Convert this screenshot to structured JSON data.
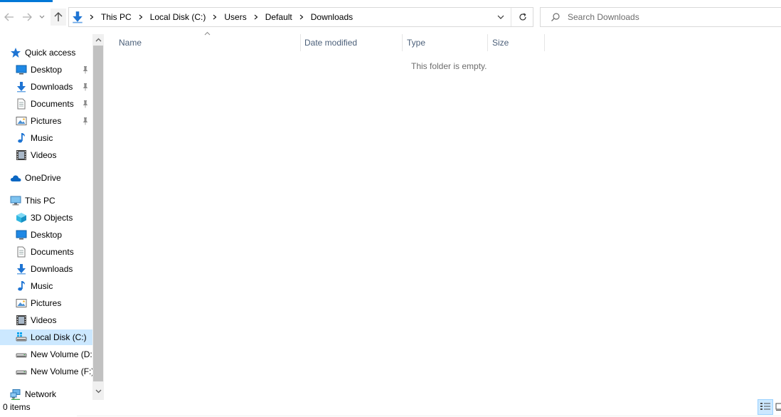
{
  "window": {
    "accent_color": "#0078d7"
  },
  "address_bar": {
    "breadcrumbs": [
      "This PC",
      "Local Disk (C:)",
      "Users",
      "Default",
      "Downloads"
    ]
  },
  "search": {
    "placeholder": "Search Downloads"
  },
  "nav_pane": {
    "quick_access": {
      "label": "Quick access",
      "items": [
        {
          "label": "Desktop",
          "icon": "desktop-icon",
          "pinned": true
        },
        {
          "label": "Downloads",
          "icon": "downloads-icon",
          "pinned": true
        },
        {
          "label": "Documents",
          "icon": "documents-icon",
          "pinned": true
        },
        {
          "label": "Pictures",
          "icon": "pictures-icon",
          "pinned": true
        },
        {
          "label": "Music",
          "icon": "music-icon",
          "pinned": false
        },
        {
          "label": "Videos",
          "icon": "videos-icon",
          "pinned": false
        }
      ]
    },
    "onedrive": {
      "label": "OneDrive"
    },
    "this_pc": {
      "label": "This PC",
      "items": [
        {
          "label": "3D Objects",
          "icon": "3d-objects-icon"
        },
        {
          "label": "Desktop",
          "icon": "desktop-icon"
        },
        {
          "label": "Documents",
          "icon": "documents-icon"
        },
        {
          "label": "Downloads",
          "icon": "downloads-icon"
        },
        {
          "label": "Music",
          "icon": "music-icon"
        },
        {
          "label": "Pictures",
          "icon": "pictures-icon"
        },
        {
          "label": "Videos",
          "icon": "videos-icon"
        },
        {
          "label": "Local Disk (C:)",
          "icon": "local-disk-icon",
          "selected": true
        },
        {
          "label": "New Volume (D:)",
          "icon": "drive-icon"
        },
        {
          "label": "New Volume (F:)",
          "icon": "drive-icon"
        }
      ]
    },
    "network": {
      "label": "Network"
    }
  },
  "columns": [
    "Name",
    "Date modified",
    "Type",
    "Size"
  ],
  "content": {
    "empty_message": "This folder is empty."
  },
  "status_bar": {
    "item_count": "0 items"
  }
}
